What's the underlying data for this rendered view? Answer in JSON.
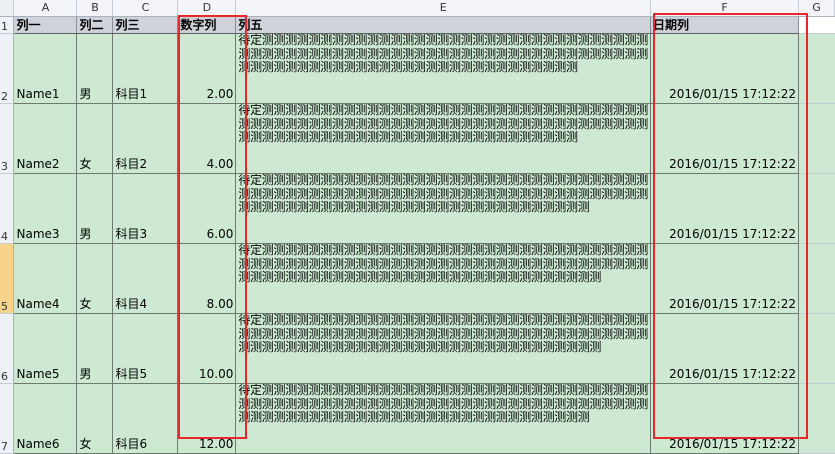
{
  "column_headers": [
    "A",
    "B",
    "C",
    "D",
    "E",
    "F",
    "G"
  ],
  "header_row": {
    "row_number": "1",
    "cells": [
      "列一",
      "列二",
      "列三",
      "数字列",
      "列五",
      "日期列",
      ""
    ]
  },
  "rows": [
    {
      "row_number": "2",
      "col1": "Name1",
      "col2": "男",
      "col3": "科目1",
      "num": "2.00",
      "text": "待定测测测测测测测测测测测测测测测测测测测测测测测测测测测测测测测测测测测测测测测测测测测测测测测测测测测测测测测测测测测测测测测测测测测测测测测测测测测测测测测测测测测测测测测测测测测测测测测测测",
      "date": "2016/01/15 17:12:22"
    },
    {
      "row_number": "3",
      "col1": "Name2",
      "col2": "女",
      "col3": "科目2",
      "num": "4.00",
      "text": "待定测测测测测测测测测测测测测测测测测测测测测测测测测测测测测测测测测测测测测测测测测测测测测测测测测测测测测测测测测测测测测测测测测测测测测测测测测测测测测测测测测测测测测测测测测测测测测测测测测",
      "date": "2016/01/15 17:12:22"
    },
    {
      "row_number": "4",
      "col1": "Name3",
      "col2": "男",
      "col3": "科目3",
      "num": "6.00",
      "text": "待定测测测测测测测测测测测测测测测测测测测测测测测测测测测测测测测测测测测测测测测测测测测测测测测测测测测测测测测测测测测测测测测测测测测测测测测测测测测测测测测测测测测测测测测测测测测测测测测测测测",
      "date": "2016/01/15 17:12:22"
    },
    {
      "row_number": "5",
      "col1": "Name4",
      "col2": "女",
      "col3": "科目4",
      "num": "8.00",
      "text": "待定测测测测测测测测测测测测测测测测测测测测测测测测测测测测测测测测测测测测测测测测测测测测测测测测测测测测测测测测测测测测测测测测测测测测测测测测测测测测测测测测测测测测测测测测测测测测测测测测测测测",
      "date": "2016/01/15 17:12:22"
    },
    {
      "row_number": "6",
      "col1": "Name5",
      "col2": "男",
      "col3": "科目5",
      "num": "10.00",
      "text": "待定测测测测测测测测测测测测测测测测测测测测测测测测测测测测测测测测测测测测测测测测测测测测测测测测测测测测测测测测测测测测测测测测测测测测测测测测测测测测测测测测测测测测测测测测测测测测测测测测测测测",
      "date": "2016/01/15 17:12:22"
    },
    {
      "row_number": "7",
      "col1": "Name6",
      "col2": "女",
      "col3": "科目6",
      "num": "12.00",
      "text": "待定测测测测测测测测测测测测测测测测测测测测测测测测测测测测测测测测测测测测测测测测测测测测测测测测测测测测测测测测测测测测测测测测测测测测测测测测测测测测测测测测测测测测测测测测测测测测测测测测测测",
      "date": "2016/01/15 17:12:22"
    }
  ],
  "selected_row": "5",
  "colors": {
    "data_fill": "#cde9d2",
    "header_fill": "#cfd2d8",
    "highlight_border": "#e8262c",
    "selected_row_header": "#f8d38a"
  }
}
